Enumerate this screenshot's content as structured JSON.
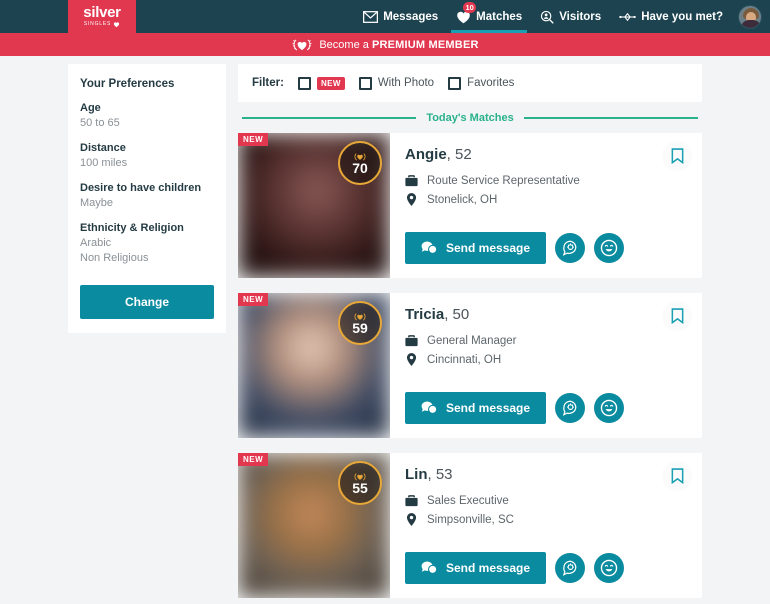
{
  "header": {
    "logo": {
      "main": "silver",
      "sub": "SINGLES"
    },
    "nav": [
      {
        "label": "Messages",
        "icon": "envelope-icon",
        "active": false,
        "badge": null
      },
      {
        "label": "Matches",
        "icon": "heart-icon",
        "active": true,
        "badge": "10"
      },
      {
        "label": "Visitors",
        "icon": "magnifier-person-icon",
        "active": false,
        "badge": null
      },
      {
        "label": "Have you met?",
        "icon": "shuffle-icon",
        "active": false,
        "badge": null
      }
    ],
    "avatar_alt": "user-avatar"
  },
  "premium_banner": {
    "prefix": "Become a ",
    "emphasis": "PREMIUM MEMBER",
    "icon": "laurel-heart-icon"
  },
  "sidebar": {
    "title": "Your Preferences",
    "prefs": [
      {
        "label": "Age",
        "values": [
          "50 to 65"
        ]
      },
      {
        "label": "Distance",
        "values": [
          "100 miles"
        ]
      },
      {
        "label": "Desire to have children",
        "values": [
          "Maybe"
        ]
      },
      {
        "label": "Ethnicity & Religion",
        "values": [
          "Arabic",
          "Non Religious"
        ]
      }
    ],
    "change_label": "Change"
  },
  "filter": {
    "label": "Filter:",
    "options": [
      {
        "text": "",
        "badge": "NEW",
        "checked": false
      },
      {
        "text": "With Photo",
        "badge": null,
        "checked": false
      },
      {
        "text": "Favorites",
        "badge": null,
        "checked": false
      }
    ]
  },
  "divider": {
    "text": "Today's Matches"
  },
  "matches": [
    {
      "new_badge": "NEW",
      "score": "70",
      "name": "Angie",
      "age": ", 52",
      "job": "Route Service Representative",
      "location": "Stonelick, OH",
      "send_label": "Send message"
    },
    {
      "new_badge": "NEW",
      "score": "59",
      "name": "Tricia",
      "age": ", 50",
      "job": "General Manager",
      "location": "Cincinnati, OH",
      "send_label": "Send message"
    },
    {
      "new_badge": "NEW",
      "score": "55",
      "name": "Lin",
      "age": ", 53",
      "job": "Sales Executive",
      "location": "Simpsonville, SC",
      "send_label": "Send message"
    }
  ],
  "colors": {
    "header_bg": "#1d4350",
    "accent_red": "#e1374f",
    "teal": "#0a8ba0",
    "green": "#2bb28c",
    "gold": "#e8a838",
    "page_bg": "#f2f4f6"
  }
}
